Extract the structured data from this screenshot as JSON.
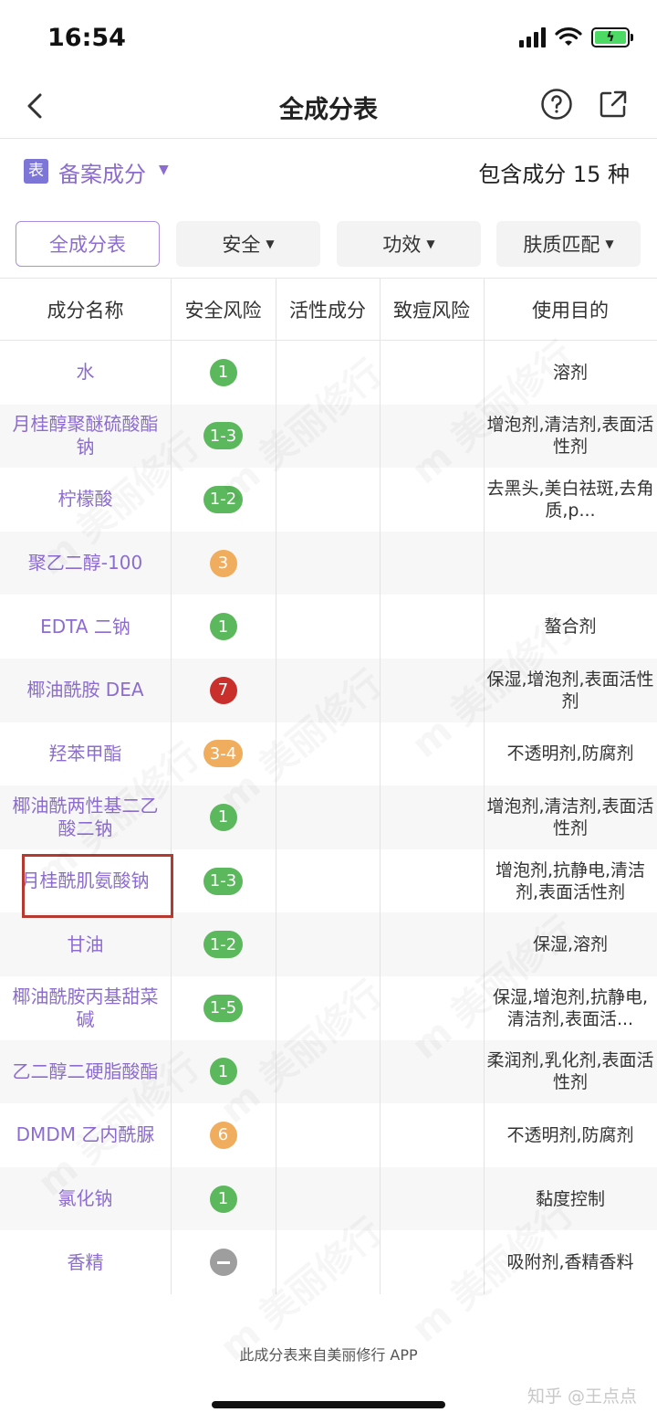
{
  "status_bar": {
    "time": "16:54"
  },
  "nav": {
    "title": "全成分表"
  },
  "filing": {
    "badge": "表",
    "label": "备案成分",
    "count_text": "包含成分 15 种"
  },
  "filters": [
    "全成分表",
    "安全",
    "功效",
    "肤质匹配"
  ],
  "table": {
    "headers": [
      "成分名称",
      "安全风险",
      "活性成分",
      "致痘风险",
      "使用目的"
    ],
    "rows": [
      {
        "name": "水",
        "risk": "1",
        "risk_color": "#5cb85c",
        "purpose": "溶剂"
      },
      {
        "name": "月桂醇聚醚硫酸酯钠",
        "risk": "1-3",
        "risk_color": "#5cb85c",
        "purpose": "增泡剂,清洁剂,表面活性剂"
      },
      {
        "name": "柠檬酸",
        "risk": "1-2",
        "risk_color": "#5cb85c",
        "purpose": "去黑头,美白祛斑,去角质,p..."
      },
      {
        "name": "聚乙二醇-100",
        "risk": "3",
        "risk_color": "#f0ad5e",
        "purpose": ""
      },
      {
        "name": "EDTA 二钠",
        "risk": "1",
        "risk_color": "#5cb85c",
        "purpose": "螯合剂"
      },
      {
        "name": "椰油酰胺 DEA",
        "risk": "7",
        "risk_color": "#c9302c",
        "purpose": "保湿,增泡剂,表面活性剂"
      },
      {
        "name": "羟苯甲酯",
        "risk": "3-4",
        "risk_color": "#f0ad5e",
        "purpose": "不透明剂,防腐剂"
      },
      {
        "name": "椰油酰两性基二乙酸二钠",
        "risk": "1",
        "risk_color": "#5cb85c",
        "purpose": "增泡剂,清洁剂,表面活性剂"
      },
      {
        "name": "月桂酰肌氨酸钠",
        "risk": "1-3",
        "risk_color": "#5cb85c",
        "purpose": "增泡剂,抗静电,清洁剂,表面活性剂"
      },
      {
        "name": "甘油",
        "risk": "1-2",
        "risk_color": "#5cb85c",
        "purpose": "保湿,溶剂"
      },
      {
        "name": "椰油酰胺丙基甜菜碱",
        "risk": "1-5",
        "risk_color": "#5cb85c",
        "purpose": "保湿,增泡剂,抗静电,清洁剂,表面活..."
      },
      {
        "name": "乙二醇二硬脂酸酯",
        "risk": "1",
        "risk_color": "#5cb85c",
        "purpose": "柔润剂,乳化剂,表面活性剂"
      },
      {
        "name": "DMDM 乙内酰脲",
        "risk": "6",
        "risk_color": "#f0ad5e",
        "purpose": "不透明剂,防腐剂"
      },
      {
        "name": "氯化钠",
        "risk": "1",
        "risk_color": "#5cb85c",
        "purpose": "黏度控制"
      },
      {
        "name": "香精",
        "risk": "",
        "risk_color": "#9e9e9e",
        "risk_icon": "minus-icon",
        "purpose": "吸附剂,香精香料"
      }
    ]
  },
  "watermark_text": "m 美丽修行",
  "footer": {
    "note": "此成分表来自美丽修行 APP",
    "zhihu": "知乎 @王点点"
  }
}
